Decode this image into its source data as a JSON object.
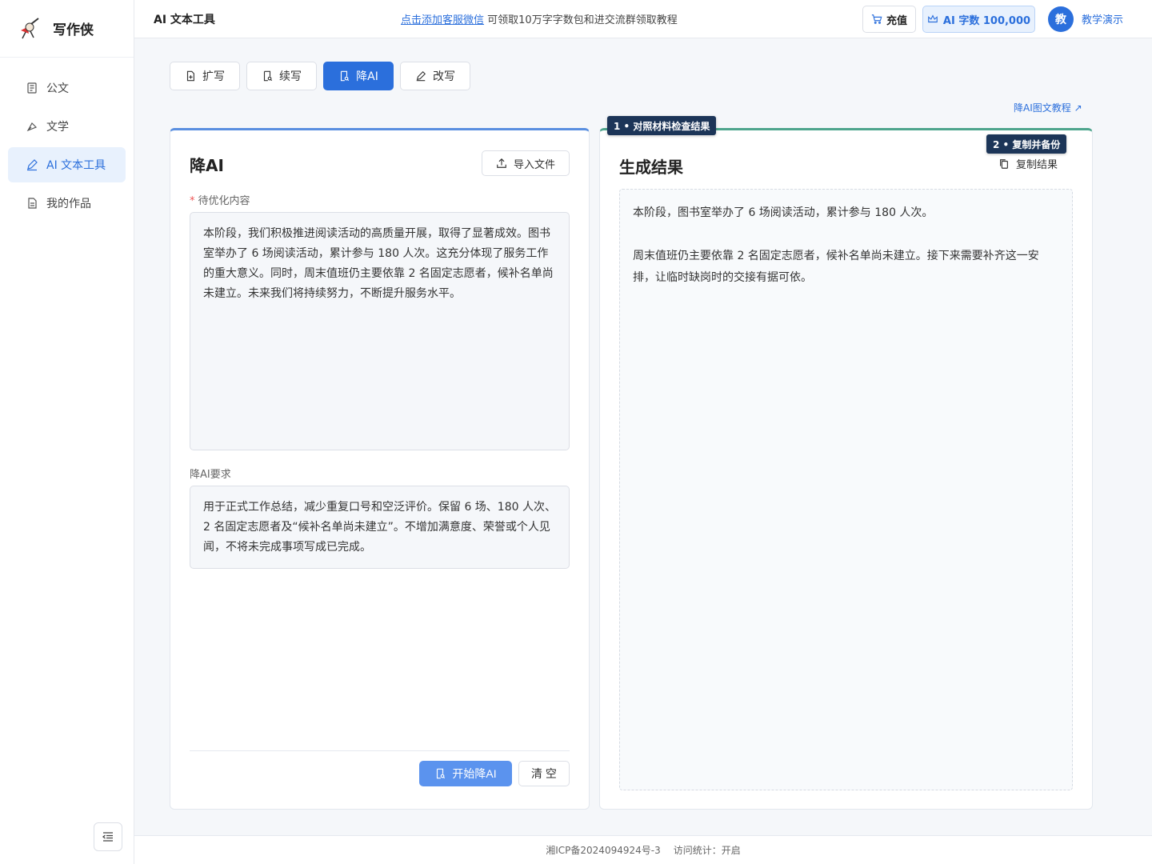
{
  "brand": {
    "name": "写作侠"
  },
  "sidebar": {
    "items": [
      {
        "label": "公文",
        "icon": "document-list-icon"
      },
      {
        "label": "文学",
        "icon": "pen-nib-icon"
      },
      {
        "label": "AI 文本工具",
        "icon": "edit-pencil-icon"
      },
      {
        "label": "我的作品",
        "icon": "file-icon"
      }
    ]
  },
  "header": {
    "title": "AI 文本工具",
    "notice_link": "点击添加客服微信",
    "notice_text": " 可领取10万字字数包和进交流群领取教程",
    "recharge_label": "充值",
    "quota_label": "AI 字数 100,000",
    "avatar_text": "教",
    "user_name": "教学演示"
  },
  "tabs": [
    {
      "label": "扩写"
    },
    {
      "label": "续写"
    },
    {
      "label": "降AI"
    },
    {
      "label": "改写"
    }
  ],
  "tutorial_link": "降AI图文教程 ↗",
  "left_panel": {
    "title": "降AI",
    "import_label": "导入文件",
    "content_label": "待优化内容",
    "content_value": "本阶段，我们积极推进阅读活动的高质量开展，取得了显著成效。图书室举办了 6 场阅读活动，累计参与 180 人次。这充分体现了服务工作的重大意义。同时，周末值班仍主要依靠 2 名固定志愿者，候补名单尚未建立。未来我们将持续努力，不断提升服务水平。",
    "requirement_label": "降AI要求",
    "requirement_value": "用于正式工作总结，减少重复口号和空泛评价。保留 6 场、180 人次、2 名固定志愿者及“候补名单尚未建立”。不增加满意度、荣誉或个人见闻，不将未完成事项写成已完成。",
    "start_label": "开始降AI",
    "clear_label": "清 空"
  },
  "right_panel": {
    "title": "生成结果",
    "copy_label": "复制结果",
    "paragraphs": [
      "本阶段，图书室举办了 6 场阅读活动，累计参与 180 人次。",
      "周末值班仍主要依靠 2 名固定志愿者，候补名单尚未建立。接下来需要补齐这一安排，让临时缺岗时的交接有据可依。"
    ]
  },
  "step_tags": {
    "step1": "1 • 对照材料检查结果",
    "step2": "2 • 复制并备份"
  },
  "footer": {
    "icp": "湘ICP备2024094924号-3",
    "stats": "访问统计：开启"
  }
}
